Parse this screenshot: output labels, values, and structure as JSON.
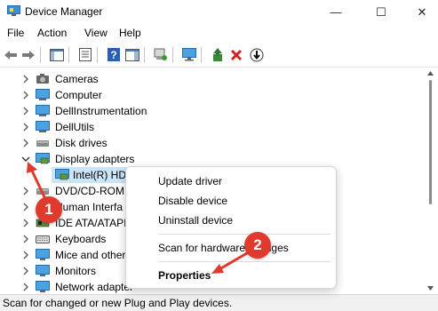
{
  "window": {
    "title": "Device Manager",
    "minimize_glyph": "—",
    "maximize_glyph": "☐",
    "close_glyph": "✕"
  },
  "menu": [
    "File",
    "Action",
    "View",
    "Help"
  ],
  "toolbar": {
    "icons": [
      "back-icon",
      "forward-icon",
      "show-hide-console-tree-icon",
      "properties-icon",
      "help-icon",
      "action-pane-icon",
      "scan-hardware-icon",
      "monitor-icon",
      "update-driver-icon",
      "uninstall-icon",
      "disable-icon"
    ]
  },
  "tree": [
    {
      "label": "Cameras",
      "expanded": false,
      "icon": "camera-icon"
    },
    {
      "label": "Computer",
      "expanded": false,
      "icon": "monitor-icon"
    },
    {
      "label": "DellInstrumentation",
      "expanded": false,
      "icon": "device-icon"
    },
    {
      "label": "DellUtils",
      "expanded": false,
      "icon": "device-icon"
    },
    {
      "label": "Disk drives",
      "expanded": false,
      "icon": "disk-drive-icon"
    },
    {
      "label": "Display adapters",
      "expanded": true,
      "icon": "display-adapter-icon"
    },
    {
      "label": "Intel(R) HD",
      "child": true,
      "selected": true,
      "icon": "display-adapter-icon"
    },
    {
      "label": "DVD/CD-ROM",
      "expanded": false,
      "icon": "dvd-drive-icon"
    },
    {
      "label": "Human Interfa",
      "expanded": false,
      "icon": "hid-icon"
    },
    {
      "label": "IDE ATA/ATAPI",
      "expanded": false,
      "icon": "ide-controller-icon"
    },
    {
      "label": "Keyboards",
      "expanded": false,
      "icon": "keyboard-icon"
    },
    {
      "label": "Mice and other",
      "expanded": false,
      "icon": "mouse-icon"
    },
    {
      "label": "Monitors",
      "expanded": false,
      "icon": "monitor-icon"
    },
    {
      "label": "Network adapter",
      "expanded": false,
      "icon": "network-adapter-icon"
    }
  ],
  "context_menu": {
    "items": [
      "Update driver",
      "Disable device",
      "Uninstall device",
      "Scan for hardware changes",
      "Properties"
    ]
  },
  "callouts": [
    "1",
    "2"
  ],
  "status_bar": "Scan for changed or new Plug and Play devices.",
  "colors": {
    "callout": "#e03a2f",
    "selection": "#cce4f7",
    "accent": "#0067c0"
  }
}
